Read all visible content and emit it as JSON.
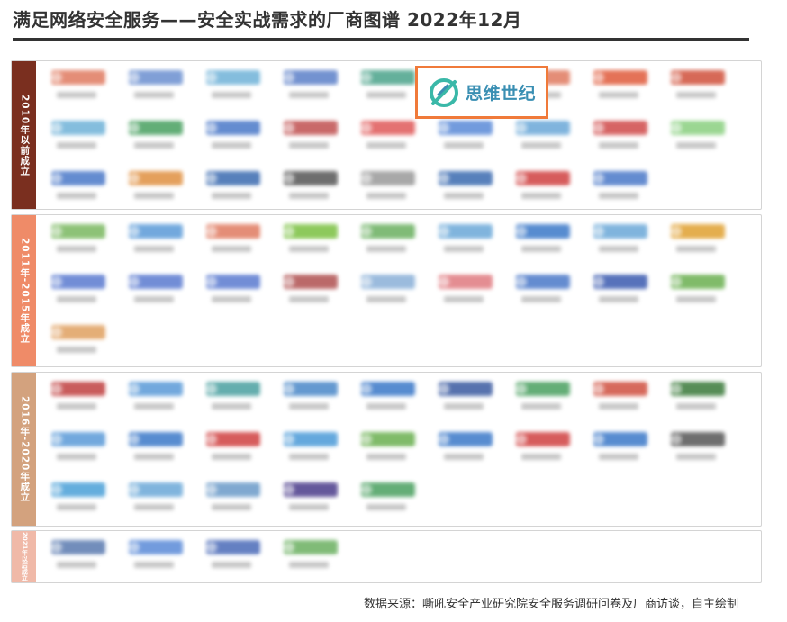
{
  "title": "满足网络安全服务——安全实战需求的厂商图谱 2022年12月",
  "highlight_logo": {
    "text": "思维世纪",
    "icon": "siwei-shiji-logo-icon",
    "color": "#3a8fb3",
    "border_color": "#f07a3a"
  },
  "source_note": "数据来源：嘶吼安全产业研究院安全服务调研问卷及厂商访谈，自主绘制",
  "bands": [
    {
      "label": "2010年以前成立",
      "color": "#7a2f1f",
      "rows": [
        [
          "#e07a60",
          "#6a8fd0",
          "#6fb2d8",
          "#5b7fc8",
          "#4aa38a",
          "",
          "#e07a60",
          "#e05a3a",
          "#d0503a"
        ],
        [
          "#6fb2d8",
          "#48a060",
          "#4a78c8",
          "#c05050",
          "#e05a5a",
          "#5a8ad8",
          "#6aa8d8",
          "#d04a4a",
          "#8ad080"
        ],
        [
          "#4a78c8",
          "#e09040",
          "#3a6ab0",
          "#555555",
          "#999999",
          "#3a6ab0",
          "#d04040",
          "#4a78c8"
        ]
      ]
    },
    {
      "label": "2011年-2015年成立",
      "color": "#ef8b68",
      "rows": [
        [
          "#7ab860",
          "#5a9ad8",
          "#e07a60",
          "#7ac040",
          "#6ab060",
          "#6aa8d8",
          "#3a78c8",
          "#6aa8d8",
          "#e0a030"
        ],
        [
          "#5a7ad0",
          "#5a7ad0",
          "#5a7ad0",
          "#b05050",
          "#8ab0d8",
          "#e07a80",
          "#4a78c8",
          "#3a5ab0",
          "#6ab050"
        ],
        [
          "#e0a060"
        ]
      ]
    },
    {
      "label": "2016年-2020年成立",
      "color": "#d3a27e",
      "rows": [
        [
          "#c04040",
          "#5a9ad8",
          "#4aa0a0",
          "#4a88c8",
          "#3a78c8",
          "#3a5aa0",
          "#4aa060",
          "#d05040",
          "#3a7a3a"
        ],
        [
          "#5a9ad8",
          "#3a78c8",
          "#d04040",
          "#4a9ad8",
          "#6ab050",
          "#3a78c8",
          "#d04040",
          "#3a78c8",
          "#555555"
        ],
        [
          "#4aa0d8",
          "#6aa8d8",
          "#6a9ac8",
          "#4a3a8a",
          "#4aa060"
        ]
      ]
    },
    {
      "label": "2021年以后成立",
      "color": "#f0b9a8",
      "rows": [
        [
          "#5a7ab0",
          "#5a8ad8",
          "#4a6ab8",
          "#6ab060"
        ]
      ]
    }
  ]
}
